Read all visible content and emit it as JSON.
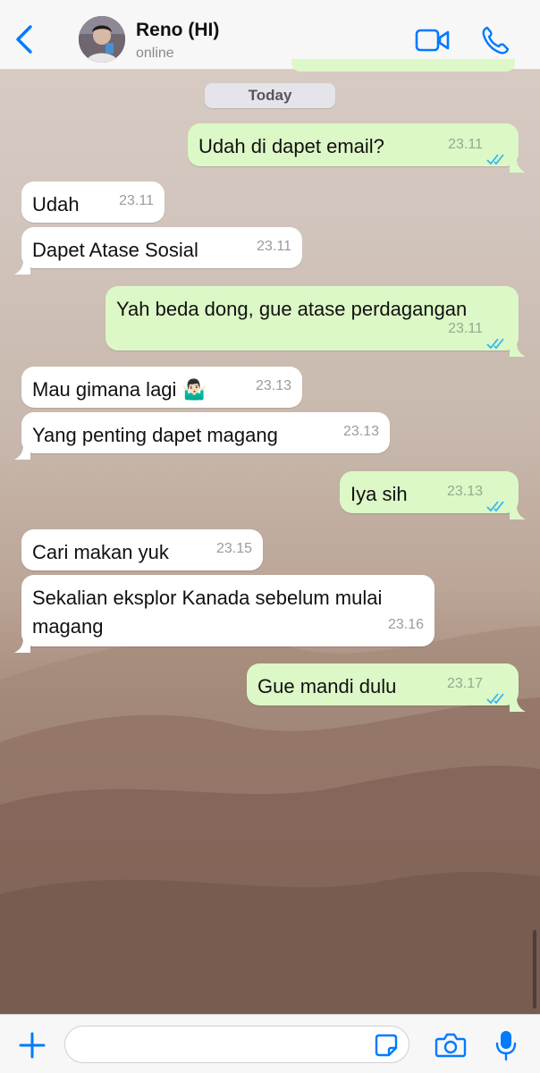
{
  "header": {
    "contact_name": "Reno (HI)",
    "status": "online",
    "icons": [
      "back-chevron-icon",
      "avatar",
      "video-call-icon",
      "phone-call-icon"
    ]
  },
  "day_separator": "Today",
  "messages": [
    {
      "direction": "out",
      "text": "Udah di dapet email?",
      "time": "23.11",
      "ticks": "read"
    },
    {
      "direction": "in",
      "text": "Udah",
      "time": "23.11"
    },
    {
      "direction": "in",
      "text": "Dapet Atase Sosial",
      "time": "23.11"
    },
    {
      "direction": "out",
      "text": "Yah beda dong, gue atase perdagangan",
      "time": "23.11",
      "ticks": "read"
    },
    {
      "direction": "in",
      "text": "Mau gimana lagi 🤷🏻‍♂️",
      "time": "23.13"
    },
    {
      "direction": "in",
      "text": "Yang penting dapet magang",
      "time": "23.13"
    },
    {
      "direction": "out",
      "text": "Iya sih",
      "time": "23.13",
      "ticks": "read"
    },
    {
      "direction": "in",
      "text": "Cari makan yuk",
      "time": "23.15"
    },
    {
      "direction": "in",
      "text": "Sekalian eksplor Kanada sebelum mulai magang",
      "time": "23.16"
    },
    {
      "direction": "out",
      "text": "Gue mandi dulu",
      "time": "23.17",
      "ticks": "read"
    }
  ],
  "composer": {
    "placeholder": "",
    "icons": [
      "plus-icon",
      "sticker-icon",
      "camera-icon",
      "microphone-icon"
    ]
  },
  "colors": {
    "accent": "#007aff",
    "outgoing_bubble": "#dcf8c6",
    "incoming_bubble": "#ffffff",
    "read_ticks": "#34b7f1"
  }
}
